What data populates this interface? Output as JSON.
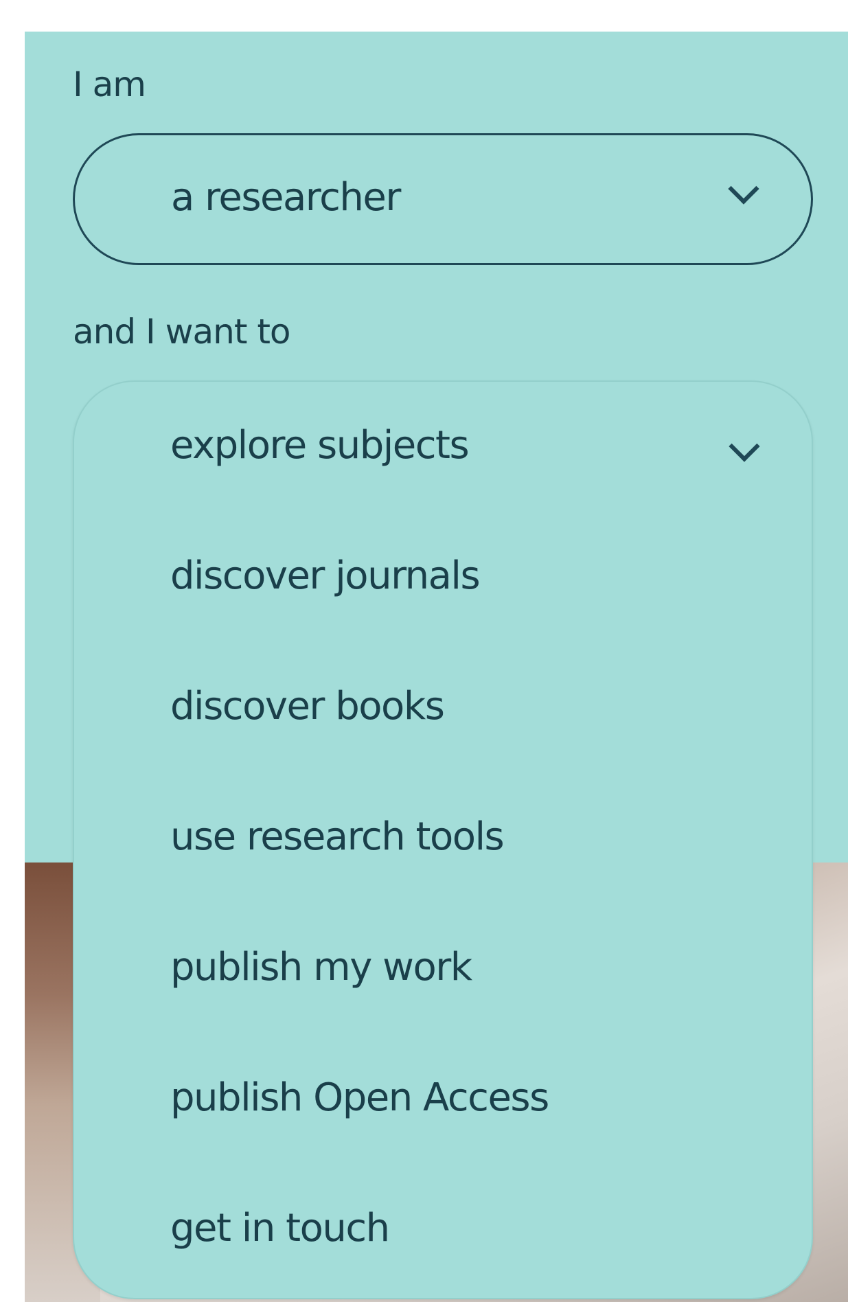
{
  "labels": {
    "i_am": "I am",
    "and_i_want_to": "and I want to"
  },
  "role_select": {
    "selected": "a researcher",
    "icon": "chevron-down-icon"
  },
  "goal_select": {
    "icon": "chevron-down-icon",
    "options": [
      "explore subjects",
      "discover journals",
      "discover books",
      "use research tools",
      "publish my work",
      "publish Open Access",
      "get in touch"
    ]
  },
  "colors": {
    "panel_bg": "#a3ddd9",
    "text": "#1a3f4a",
    "border": "#1f4856"
  }
}
